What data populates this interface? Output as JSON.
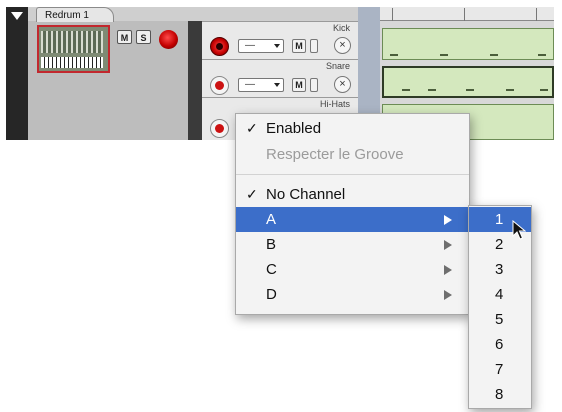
{
  "device": {
    "name": "Redrum 1",
    "mute_label": "M",
    "solo_label": "S"
  },
  "lanes": [
    {
      "label": "Kick",
      "combo": "—",
      "mute_label": "M",
      "rec_active": true
    },
    {
      "label": "Snare",
      "combo": "—",
      "mute_label": "M",
      "rec_active": false
    },
    {
      "label": "Hi-Hats",
      "rec_active": false
    }
  ],
  "context_menu": {
    "items": [
      {
        "label": "Enabled",
        "checked": true,
        "enabled": true
      },
      {
        "label": "Respecter le Groove",
        "checked": false,
        "enabled": false
      },
      {
        "label": "No Channel",
        "checked": true,
        "enabled": true
      },
      {
        "label": "A",
        "submenu": true,
        "highlighted": true
      },
      {
        "label": "B",
        "submenu": true
      },
      {
        "label": "C",
        "submenu": true
      },
      {
        "label": "D",
        "submenu": true
      }
    ],
    "check_glyph": "✓"
  },
  "submenu": {
    "items": [
      "1",
      "2",
      "3",
      "4",
      "5",
      "6",
      "7",
      "8"
    ],
    "highlighted_index": 0
  },
  "colors": {
    "highlight": "#3c6ec9",
    "record_red": "#c30000",
    "clip_green": "#d4e8be"
  }
}
